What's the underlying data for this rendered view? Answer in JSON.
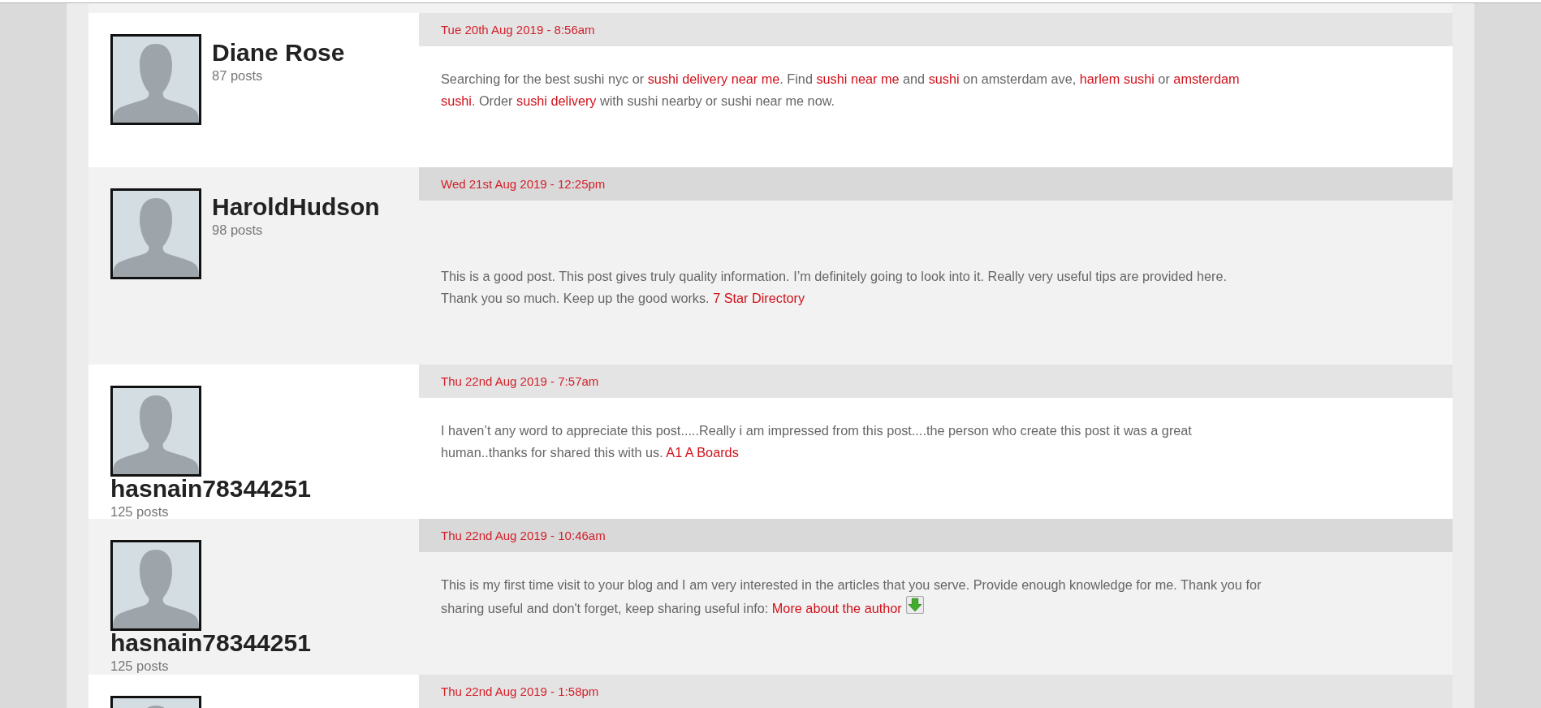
{
  "posts": [
    {
      "author": {
        "name": "Diane Rose",
        "post_count": "87 posts"
      },
      "date": "Tue 20th Aug 2019 - 8:56am",
      "body": [
        {
          "kind": "text",
          "text": "Searching for the best sushi nyc or "
        },
        {
          "kind": "link",
          "text": "sushi delivery near me"
        },
        {
          "kind": "text",
          "text": ". Find "
        },
        {
          "kind": "link",
          "text": "sushi near me"
        },
        {
          "kind": "text",
          "text": " and "
        },
        {
          "kind": "link",
          "text": "sushi"
        },
        {
          "kind": "text",
          "text": " on amsterdam ave, "
        },
        {
          "kind": "link",
          "text": "harlem sushi"
        },
        {
          "kind": "text",
          "text": " or "
        },
        {
          "kind": "link",
          "text": "amsterdam "
        },
        {
          "kind": "link",
          "text": "sushi"
        },
        {
          "kind": "text",
          "text": ". Order "
        },
        {
          "kind": "link",
          "text": "sushi delivery"
        },
        {
          "kind": "text",
          "text": " with sushi nearby or sushi near me now."
        }
      ]
    },
    {
      "author": {
        "name": "HaroldHudson",
        "post_count": "98 posts"
      },
      "date": "Wed 21st Aug 2019 - 12:25pm",
      "body": [
        {
          "kind": "text",
          "text": "This is a good post. This post gives truly quality information. I’m definitely going to look into it. Really very useful tips are provided here. Thank you so much. Keep up the good works. "
        },
        {
          "kind": "link",
          "text": "7 Star Directory"
        }
      ]
    },
    {
      "author": {
        "name": "hasnain78344251",
        "post_count": "125 posts"
      },
      "date": "Thu 22nd Aug 2019 - 7:57am",
      "body": [
        {
          "kind": "text",
          "text": "I haven’t any word to appreciate this post.....Really i am impressed from this post....the person who create this post it was a great human..thanks for shared this with us. "
        },
        {
          "kind": "link",
          "text": "A1 A Boards"
        }
      ]
    },
    {
      "author": {
        "name": "hasnain78344251",
        "post_count": "125 posts"
      },
      "date": "Thu 22nd Aug 2019 - 10:46am",
      "body": [
        {
          "kind": "text",
          "text": "This is my first time visit to your blog and I am very interested in the articles that you serve. Provide enough knowledge for me. Thank you for sharing useful and don't forget, keep sharing useful info: "
        },
        {
          "kind": "link",
          "text": "More about the author"
        },
        {
          "kind": "image"
        }
      ]
    },
    {
      "date": "Thu 22nd Aug 2019 - 1:58pm"
    }
  ]
}
